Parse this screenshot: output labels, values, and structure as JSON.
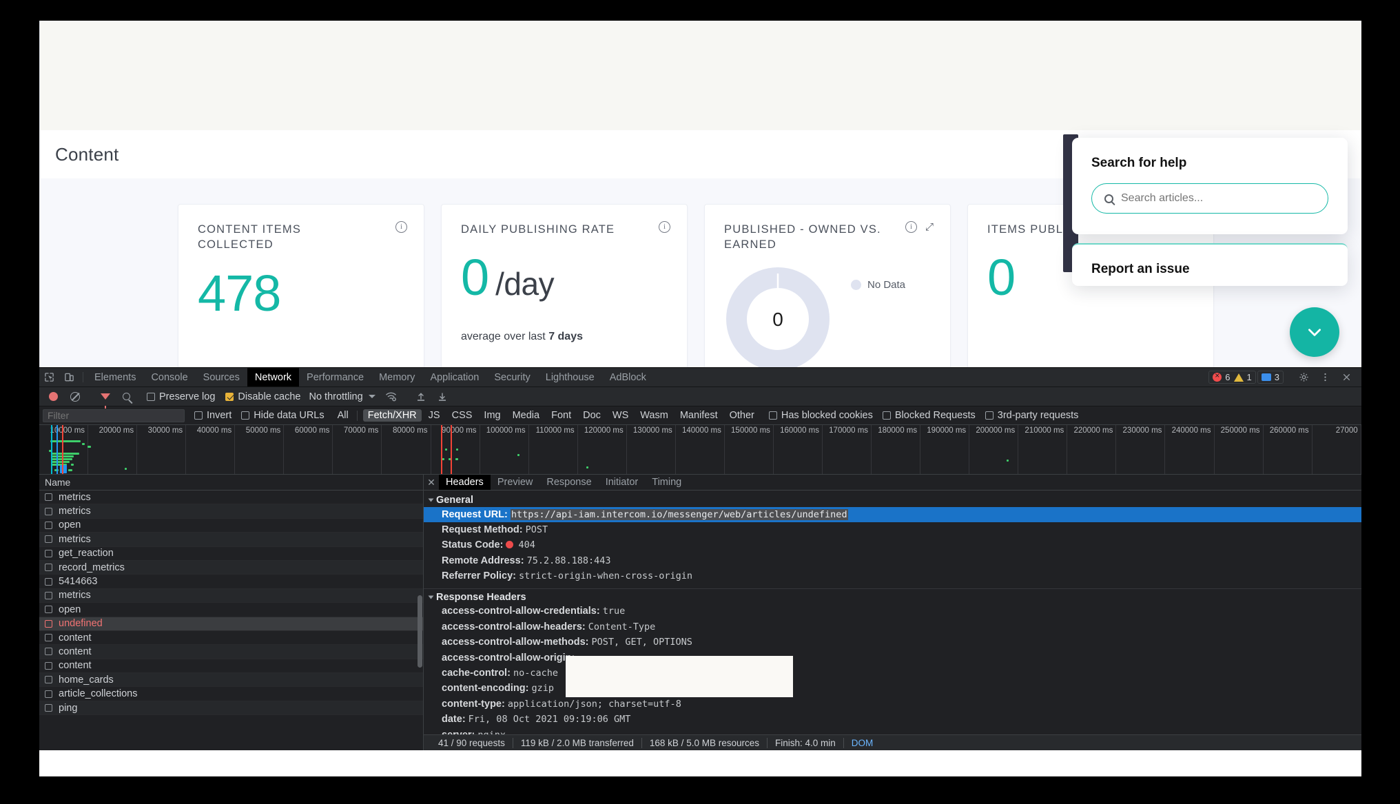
{
  "app": {
    "page_title": "Content",
    "cards": [
      {
        "title": "CONTENT ITEMS COLLECTED",
        "value": "478",
        "type": "number",
        "has_info": true,
        "has_expand": false
      },
      {
        "title": "DAILY PUBLISHING RATE",
        "value": "0",
        "unit": "/day",
        "sub_prefix": "average over last ",
        "sub_strong": "7 days",
        "type": "rate",
        "has_info": true,
        "has_expand": false
      },
      {
        "title": "PUBLISHED - OWNED VS. EARNED",
        "value": "0",
        "legend_label": "No Data",
        "type": "donut",
        "has_info": true,
        "has_expand": true
      },
      {
        "title": "ITEMS PUBLIS",
        "value": "0",
        "type": "number",
        "has_info": false,
        "has_expand": false
      }
    ],
    "accent_color": "#14b8a6",
    "donut_color": "#dfe3f0"
  },
  "messenger": {
    "search_heading": "Search for help",
    "search_placeholder": "Search articles...",
    "report_heading": "Report an issue",
    "launcher_icon": "chevron-down-icon",
    "accent_color": "#14b5a4"
  },
  "devtools": {
    "tabs": [
      {
        "label": "Elements",
        "active": false
      },
      {
        "label": "Console",
        "active": false
      },
      {
        "label": "Sources",
        "active": false
      },
      {
        "label": "Network",
        "active": true
      },
      {
        "label": "Performance",
        "active": false
      },
      {
        "label": "Memory",
        "active": false
      },
      {
        "label": "Application",
        "active": false
      },
      {
        "label": "Security",
        "active": false
      },
      {
        "label": "Lighthouse",
        "active": false
      },
      {
        "label": "AdBlock",
        "active": false
      }
    ],
    "counters": {
      "errors": "6",
      "warnings": "1",
      "messages": "3"
    },
    "toolbar": {
      "preserve_log_label": "Preserve log",
      "preserve_log_checked": false,
      "disable_cache_label": "Disable cache",
      "disable_cache_checked": true,
      "throttling_label": "No throttling"
    },
    "filterbar": {
      "filter_placeholder": "Filter",
      "invert_label": "Invert",
      "hide_data_urls_label": "Hide data URLs",
      "types": [
        {
          "label": "All",
          "active": false
        },
        {
          "label": "Fetch/XHR",
          "active": true
        },
        {
          "label": "JS",
          "active": false
        },
        {
          "label": "CSS",
          "active": false
        },
        {
          "label": "Img",
          "active": false
        },
        {
          "label": "Media",
          "active": false
        },
        {
          "label": "Font",
          "active": false
        },
        {
          "label": "Doc",
          "active": false
        },
        {
          "label": "WS",
          "active": false
        },
        {
          "label": "Wasm",
          "active": false
        },
        {
          "label": "Manifest",
          "active": false
        },
        {
          "label": "Other",
          "active": false
        }
      ],
      "checks": [
        {
          "label": "Has blocked cookies",
          "checked": false
        },
        {
          "label": "Blocked Requests",
          "checked": false
        },
        {
          "label": "3rd-party requests",
          "checked": false
        }
      ]
    },
    "timeline_ticks": [
      "10000 ms",
      "20000 ms",
      "30000 ms",
      "40000 ms",
      "50000 ms",
      "60000 ms",
      "70000 ms",
      "80000 ms",
      "90000 ms",
      "100000 ms",
      "110000 ms",
      "120000 ms",
      "130000 ms",
      "140000 ms",
      "150000 ms",
      "160000 ms",
      "170000 ms",
      "180000 ms",
      "190000 ms",
      "200000 ms",
      "210000 ms",
      "220000 ms",
      "230000 ms",
      "240000 ms",
      "250000 ms",
      "260000 ms",
      "27000"
    ],
    "requests_column_header": "Name",
    "requests": [
      {
        "name": "ping",
        "selected": false
      },
      {
        "name": "article_collections",
        "selected": false
      },
      {
        "name": "home_cards",
        "selected": false
      },
      {
        "name": "content",
        "selected": false
      },
      {
        "name": "content",
        "selected": false
      },
      {
        "name": "content",
        "selected": false
      },
      {
        "name": "undefined",
        "selected": true
      },
      {
        "name": "open",
        "selected": false
      },
      {
        "name": "metrics",
        "selected": false
      },
      {
        "name": "5414663",
        "selected": false
      },
      {
        "name": "record_metrics",
        "selected": false
      },
      {
        "name": "get_reaction",
        "selected": false
      },
      {
        "name": "metrics",
        "selected": false
      },
      {
        "name": "open",
        "selected": false
      },
      {
        "name": "metrics",
        "selected": false
      },
      {
        "name": "metrics",
        "selected": false
      }
    ],
    "detail_tabs": [
      {
        "label": "Headers",
        "active": true
      },
      {
        "label": "Preview",
        "active": false
      },
      {
        "label": "Response",
        "active": false
      },
      {
        "label": "Initiator",
        "active": false
      },
      {
        "label": "Timing",
        "active": false
      }
    ],
    "general_section": {
      "title": "General",
      "rows": [
        {
          "key": "Request URL:",
          "value": "https://api-iam.intercom.io/messenger/web/articles/undefined",
          "highlighted": true
        },
        {
          "key": "Request Method:",
          "value": "POST",
          "highlighted": false
        },
        {
          "key": "Status Code:",
          "value": "404",
          "status": true,
          "highlighted": false
        },
        {
          "key": "Remote Address:",
          "value": "75.2.88.188:443",
          "highlighted": false
        },
        {
          "key": "Referrer Policy:",
          "value": "strict-origin-when-cross-origin",
          "highlighted": false
        }
      ]
    },
    "response_headers_section": {
      "title": "Response Headers",
      "rows": [
        {
          "key": "access-control-allow-credentials:",
          "value": "true"
        },
        {
          "key": "access-control-allow-headers:",
          "value": "Content-Type"
        },
        {
          "key": "access-control-allow-methods:",
          "value": "POST, GET, OPTIONS"
        },
        {
          "key": "access-control-allow-origin:",
          "value": ""
        },
        {
          "key": "cache-control:",
          "value": "no-cache"
        },
        {
          "key": "content-encoding:",
          "value": "gzip"
        },
        {
          "key": "content-type:",
          "value": "application/json; charset=utf-8"
        },
        {
          "key": "date:",
          "value": "Fri, 08 Oct 2021 09:19:06 GMT"
        },
        {
          "key": "server:",
          "value": "nginx"
        }
      ]
    },
    "status_bar": [
      "41 / 90 requests",
      "119 kB / 2.0 MB transferred",
      "168 kB / 5.0 MB resources",
      "Finish: 4.0 min",
      "DOM"
    ]
  }
}
